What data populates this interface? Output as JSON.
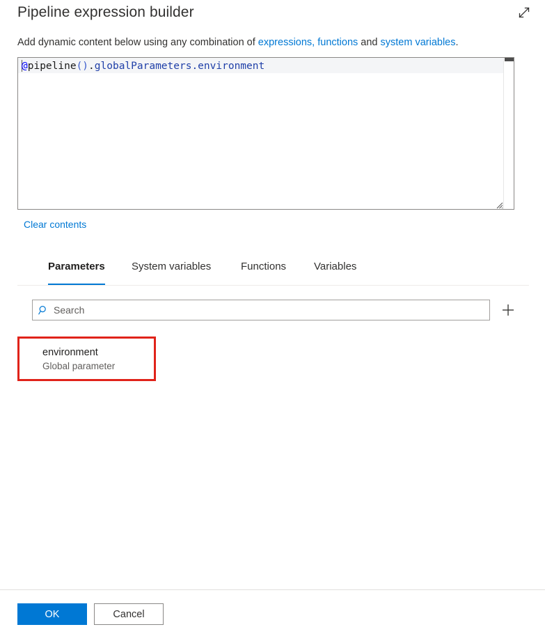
{
  "header": {
    "title": "Pipeline expression builder",
    "expand_icon": "expand-diagonal-icon"
  },
  "description": {
    "prefix": "Add dynamic content below using any combination of ",
    "link_expressions": "expressions, functions",
    "middle": " and ",
    "link_system_variables": "system variables",
    "suffix": "."
  },
  "editor": {
    "expression": "@pipeline().globalParameters.environment",
    "tokens": {
      "at": "@",
      "func": "pipeline",
      "parens": "()",
      "dot1": ".",
      "prop": "globalParameters.environment"
    }
  },
  "clear_contents_label": "Clear contents",
  "tabs": [
    {
      "label": "Parameters",
      "active": true
    },
    {
      "label": "System variables",
      "active": false
    },
    {
      "label": "Functions",
      "active": false
    },
    {
      "label": "Variables",
      "active": false
    }
  ],
  "search": {
    "placeholder": "Search",
    "value": "",
    "icon": "search-icon",
    "add_icon": "plus-icon"
  },
  "parameters": [
    {
      "name": "environment",
      "subtitle": "Global parameter",
      "highlighted": true
    }
  ],
  "footer": {
    "ok_label": "OK",
    "cancel_label": "Cancel"
  },
  "colors": {
    "accent": "#0078d4",
    "link": "#0078d4",
    "highlight_border": "#e0231a",
    "text": "#201f1e",
    "muted_text": "#605e5c",
    "expression_keyword": "#0000ff",
    "expression_property": "#1f3fa8"
  }
}
